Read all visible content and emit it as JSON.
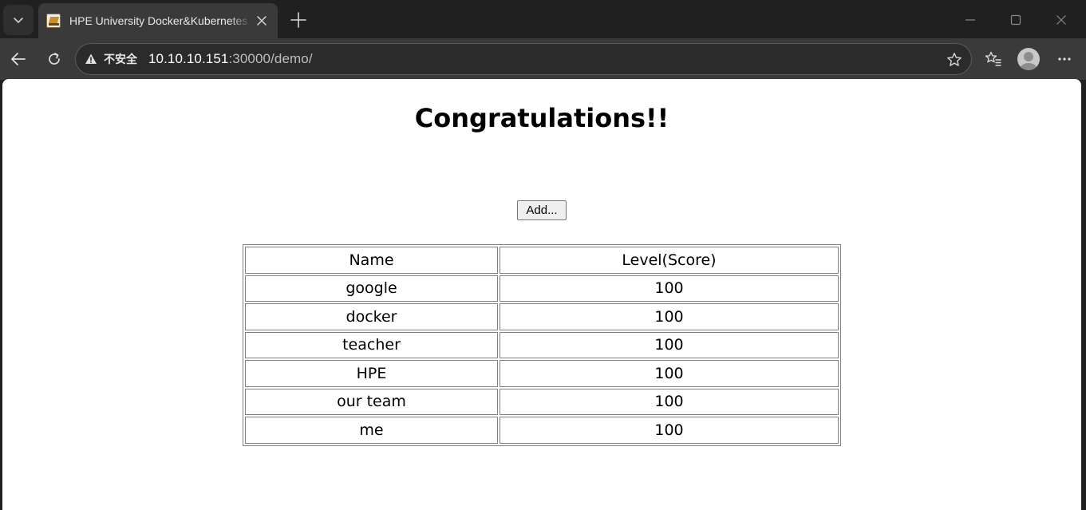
{
  "browser": {
    "tab": {
      "title": "HPE University Docker&Kubernetes"
    },
    "address_bar": {
      "security_label": "不安全",
      "url_host": "10.10.10.151",
      "url_rest": ":30000/demo/"
    }
  },
  "page": {
    "heading": "Congratulations!!",
    "add_button_label": "Add...",
    "table": {
      "headers": [
        "Name",
        "Level(Score)"
      ],
      "rows": [
        [
          "google",
          "100"
        ],
        [
          "docker",
          "100"
        ],
        [
          "teacher",
          "100"
        ],
        [
          "HPE",
          "100"
        ],
        [
          "our team",
          "100"
        ],
        [
          "me",
          "100"
        ]
      ]
    }
  }
}
